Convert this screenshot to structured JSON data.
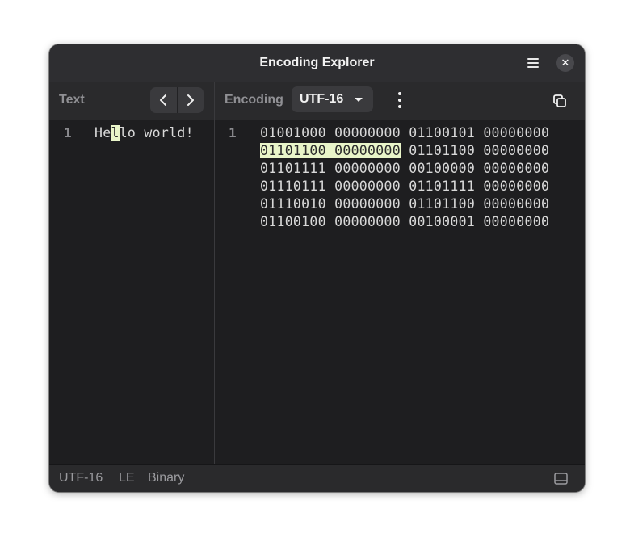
{
  "window": {
    "title": "Encoding Explorer"
  },
  "titlebar": {
    "menu_icon": "hamburger-menu-icon",
    "close_label": "✕"
  },
  "left_pane": {
    "label": "Text",
    "line_number": "1",
    "text_before_cursor": "He",
    "text_cursor_char": "l",
    "text_after_cursor": "lo world!"
  },
  "right_pane": {
    "label": "Encoding",
    "encoding_value": "UTF-16",
    "line_number": "1",
    "binary_lines": [
      [
        "01001000",
        "00000000",
        "01100101",
        "00000000"
      ],
      [
        "01101100",
        "00000000",
        "01101100",
        "00000000"
      ],
      [
        "01101111",
        "00000000",
        "00100000",
        "00000000"
      ],
      [
        "01110111",
        "00000000",
        "01101111",
        "00000000"
      ],
      [
        "01110010",
        "00000000",
        "01101100",
        "00000000"
      ],
      [
        "01100100",
        "00000000",
        "00100001",
        "00000000"
      ]
    ],
    "highlighted": {
      "row": 1,
      "bytes": [
        0,
        1
      ]
    }
  },
  "statusbar": {
    "encoding": "UTF-16",
    "endianness": "LE",
    "format": "Binary"
  },
  "colors": {
    "highlight": "#e9f5c9",
    "window_bg": "#1e1e20",
    "header_bg": "#2a2a2c"
  }
}
